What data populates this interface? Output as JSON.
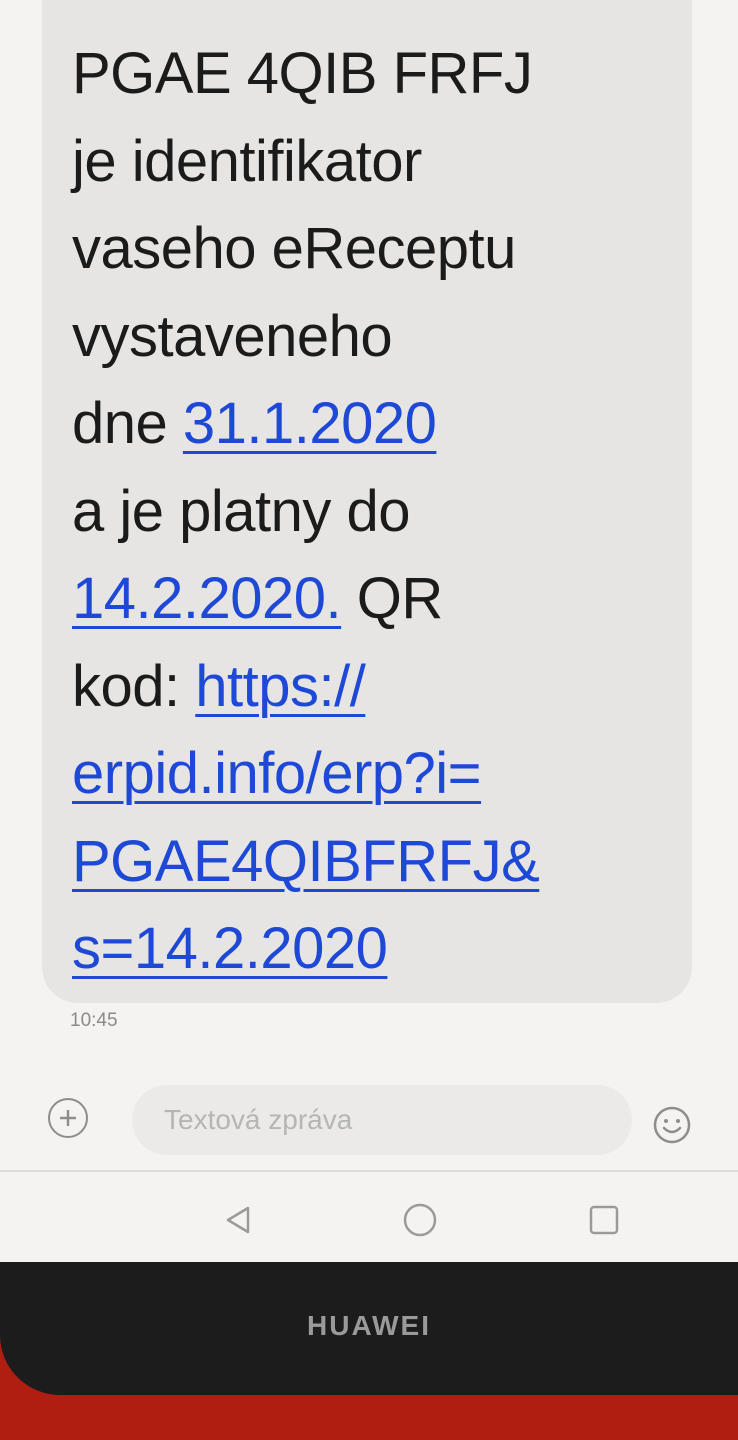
{
  "message": {
    "lines": [
      [
        {
          "text": "PGAE 4QIB FRFJ",
          "link": false
        }
      ],
      [
        {
          "text": "je identifikator",
          "link": false
        }
      ],
      [
        {
          "text": "vaseho eReceptu",
          "link": false
        }
      ],
      [
        {
          "text": "vystaveneho",
          "link": false
        }
      ],
      [
        {
          "text": "dne ",
          "link": false
        },
        {
          "text": "31.1.2020",
          "link": true
        }
      ],
      [
        {
          "text": "a je platny do",
          "link": false
        }
      ],
      [
        {
          "text": "14.2.2020.",
          "link": true
        },
        {
          "text": " QR",
          "link": false
        }
      ],
      [
        {
          "text": "kod: ",
          "link": false
        },
        {
          "text": "https://",
          "link": true
        }
      ],
      [
        {
          "text": "erpid.info/erp?i=",
          "link": true
        }
      ],
      [
        {
          "text": "PGAE4QIBFRFJ&",
          "link": true
        }
      ],
      [
        {
          "text": "s=14.2.2020",
          "link": true
        }
      ]
    ],
    "timestamp": "10:45"
  },
  "composer": {
    "placeholder": "Textová zpráva",
    "value": "",
    "attach_icon": "plus-circle-icon",
    "emoji_icon": "smiley-icon"
  },
  "navbar": {
    "back_icon": "triangle-back-icon",
    "home_icon": "circle-home-icon",
    "recent_icon": "square-recent-icon"
  },
  "device": {
    "brand": "HUAWEI"
  },
  "colors": {
    "link": "#1e49d6",
    "bubble": "#e6e5e3",
    "background": "#f4f3f2"
  }
}
